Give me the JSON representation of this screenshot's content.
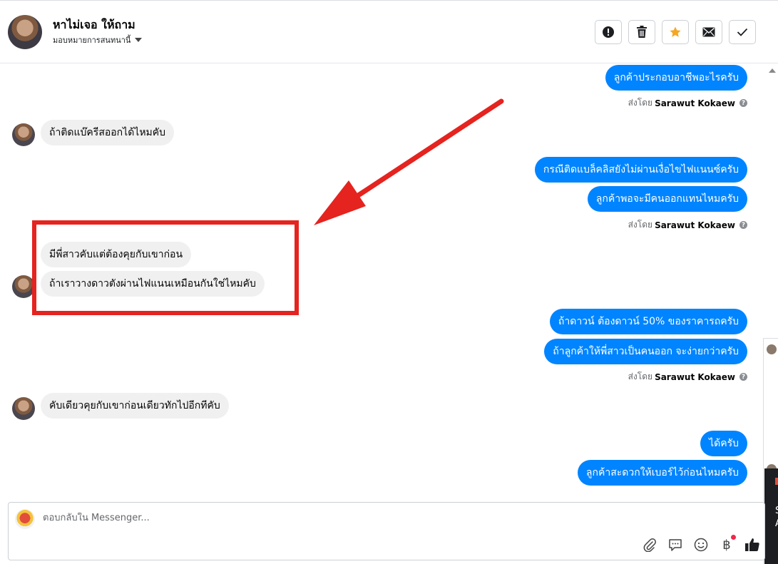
{
  "header": {
    "contact_name": "หาไม่เจอ ให้ถาม",
    "assign_label": "มอบหมายการสนทนานี้",
    "toolbar": [
      "alert-icon",
      "trash-icon",
      "star-icon",
      "envelope-icon",
      "check-icon"
    ],
    "accent_color": "#f5a623"
  },
  "messages": {
    "m1": "ลูกค้าประกอบอาชีพอะไรครับ",
    "m2": "ถ้าติดแบ๊ครีสออกได้ไหมคับ",
    "m3": "กรณีติดแบล็คลิสยังไม่ผ่านเงื่อไขไฟแนนซ์ครับ",
    "m4": "ลูกค้าพอจะมีคนออกแทนไหมครับ",
    "m5": "มีพี่สาวคับแต่ต้องคุยกับเขาก่อน",
    "m6": "ถ้าเราวางดาวตังผ่านไฟแนนเหมือนกันใช่ไหมคับ",
    "m7": "ถ้าดาวน์ ต้องดาวน์ 50% ของราคารถครับ",
    "m8": "ถ้าลูกค้าให้พี่สาวเป็นคนออก จะง่ายกว่าครับ",
    "m9": "คับเดียวคุยกับเขาก่อนเดียวทักไปอีกทีคับ",
    "m10": "ได้ครับ",
    "m11": "ลูกค้าสะดวกให้เบอร์ไว้ก่อนไหมครับ"
  },
  "sent_by": {
    "prefix": "ส่งโดย",
    "name": "Sarawut Kokaew"
  },
  "composer": {
    "placeholder": "ตอบกลับใน Messenger...",
    "tools": [
      "paperclip-icon",
      "chat-bubble-icon",
      "emoji-icon",
      "baht-icon",
      "thumbs-up-icon"
    ]
  },
  "side_panel": {
    "letters": [
      "S",
      "A"
    ]
  },
  "colors": {
    "outgoing": "#0084ff",
    "incoming": "#f0f0f0",
    "annotation": "#e5231f"
  }
}
